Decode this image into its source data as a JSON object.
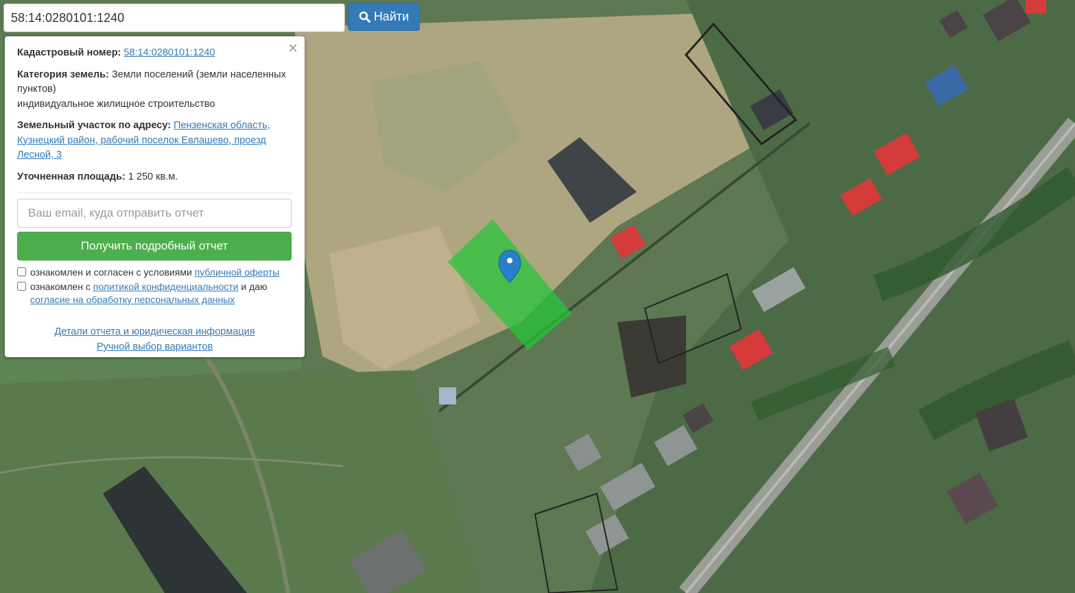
{
  "search": {
    "value": "58:14:0280101:1240",
    "button_label": "Найти",
    "button_icon": "search-icon"
  },
  "panel": {
    "close_symbol": "×",
    "cadastral_label": "Кадастровый номер:",
    "cadastral_value": "58:14:0280101:1240",
    "category_label": "Категория земель:",
    "category_value": "Земли поселений (земли населенных пунктов)",
    "category_use": "индивидуальное жилищное строительство",
    "address_label": "Земельный участок по адресу:",
    "address_value": "Пензенская область, Кузнецкий район, рабочий поселок Евлашево, проезд Лесной, 3",
    "area_label": "Уточненная площадь:",
    "area_value": "1 250 кв.м.",
    "email_placeholder": "Ваш email, куда отправить отчет",
    "report_button": "Получить подробный отчет",
    "agree1_text": "ознакомлен и согласен с условиями",
    "agree1_link": "публичной оферты",
    "agree2_text_a": "ознакомлен с",
    "agree2_link_a": "политикой конфиденциальности",
    "agree2_text_b": "и даю",
    "agree2_link_b": "согласие на обработку персональных данных",
    "details_link": "Детали отчета и юридическая информация",
    "manual_link": "Ручной выбор вариантов"
  },
  "colors": {
    "search_button": "#337ab7",
    "report_button": "#4cae4c",
    "parcel_fill": "#27c43a",
    "marker": "#2a7fc9",
    "link": "#337ab7"
  }
}
